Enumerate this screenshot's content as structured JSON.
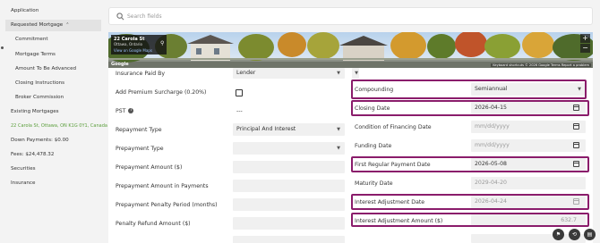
{
  "search": {
    "placeholder": "Search fields"
  },
  "sidebar": {
    "items": [
      {
        "label": "Application"
      },
      {
        "label": "Requested Mortgage"
      },
      {
        "label": "Commitment"
      },
      {
        "label": "Mortgage Terms"
      },
      {
        "label": "Amount To Be Advanced"
      },
      {
        "label": "Closing Instructions"
      },
      {
        "label": "Broker Commission"
      },
      {
        "label": "Existing Mortgages"
      },
      {
        "label": "22 Carola St, Ottawa, ON K1G 0Y1, Canada"
      },
      {
        "label": "Down Payments: $0.00"
      },
      {
        "label": "Fees: $24,478.32"
      },
      {
        "label": "Securities"
      },
      {
        "label": "Insurance"
      }
    ]
  },
  "map": {
    "title": "22 Carola St",
    "subtitle": "Ottawa, Ontario",
    "link": "View on Google Maps",
    "brand": "Google",
    "footer": "Keyboard shortcuts   © 2026 Google   Terms   Report a problem",
    "zoom_in": "+",
    "zoom_out": "−"
  },
  "left_fields": [
    {
      "label": "Insurance Paid By",
      "value": "Lender",
      "type": "select"
    },
    {
      "label": "Add Premium Surcharge (0.20%)",
      "type": "checkbox"
    },
    {
      "label": "PST",
      "value": "---",
      "type": "text"
    },
    {
      "label": "Repayment Type",
      "value": "Principal And Interest",
      "type": "select"
    },
    {
      "label": "Prepayment Type",
      "value": "",
      "type": "select"
    },
    {
      "label": "Prepayment Amount ($)",
      "value": "",
      "type": "input"
    },
    {
      "label": "Prepayment Amount in Payments",
      "value": "",
      "type": "input"
    },
    {
      "label": "Prepayment Penalty Period (months)",
      "value": "",
      "type": "input"
    },
    {
      "label": "Penalty Refund Amount ($)",
      "value": "",
      "type": "input"
    }
  ],
  "right_fields": [
    {
      "label": "Compounding",
      "value": "Semiannual",
      "type": "select"
    },
    {
      "label": "Closing Date",
      "value": "2026-04-15",
      "type": "date"
    },
    {
      "label": "Condition of Financing Date",
      "value": "mm/dd/yyyy",
      "type": "date"
    },
    {
      "label": "Funding Date",
      "value": "mm/dd/yyyy",
      "type": "date"
    },
    {
      "label": "First Regular Payment Date",
      "value": "2026-05-08",
      "type": "date"
    },
    {
      "label": "Maturity Date",
      "value": "2029-04-20",
      "type": "readonly"
    },
    {
      "label": "Interest Adjustment Date",
      "value": "2026-04-24",
      "type": "date"
    },
    {
      "label": "Interest Adjustment Amount ($)",
      "value": "632.7",
      "type": "readonly"
    }
  ],
  "colors": {
    "highlight": "#8a1c6b",
    "link_green": "#5a9e3b"
  }
}
